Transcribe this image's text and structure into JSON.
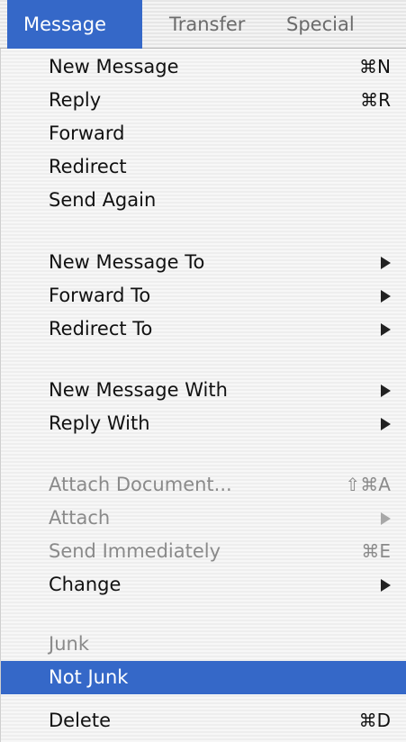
{
  "menubar": {
    "titles": [
      "Message",
      "Transfer",
      "Special"
    ],
    "colors": {
      "highlight": "#3568c8",
      "disabled_text": "#8a8a8a"
    }
  },
  "menu": {
    "items": [
      {
        "label": "New Message",
        "shortcut": "⌘N",
        "submenu": false,
        "enabled": true
      },
      {
        "label": "Reply",
        "shortcut": "⌘R",
        "submenu": false,
        "enabled": true
      },
      {
        "label": "Forward",
        "shortcut": "",
        "submenu": false,
        "enabled": true
      },
      {
        "label": "Redirect",
        "shortcut": "",
        "submenu": false,
        "enabled": true
      },
      {
        "label": "Send Again",
        "shortcut": "",
        "submenu": false,
        "enabled": true
      },
      {
        "label": "New Message To",
        "shortcut": "",
        "submenu": true,
        "enabled": true
      },
      {
        "label": "Forward To",
        "shortcut": "",
        "submenu": true,
        "enabled": true
      },
      {
        "label": "Redirect To",
        "shortcut": "",
        "submenu": true,
        "enabled": true
      },
      {
        "label": "New Message With",
        "shortcut": "",
        "submenu": true,
        "enabled": true
      },
      {
        "label": "Reply With",
        "shortcut": "",
        "submenu": true,
        "enabled": true
      },
      {
        "label": "Attach Document...",
        "shortcut": "⇧⌘A",
        "submenu": false,
        "enabled": false
      },
      {
        "label": "Attach",
        "shortcut": "",
        "submenu": true,
        "enabled": false
      },
      {
        "label": "Send Immediately",
        "shortcut": "⌘E",
        "submenu": false,
        "enabled": false
      },
      {
        "label": "Change",
        "shortcut": "",
        "submenu": true,
        "enabled": true
      },
      {
        "label": "Junk",
        "shortcut": "",
        "submenu": false,
        "enabled": false
      },
      {
        "label": "Not Junk",
        "shortcut": "",
        "submenu": false,
        "enabled": true,
        "highlighted": true
      },
      {
        "label": "Delete",
        "shortcut": "⌘D",
        "submenu": false,
        "enabled": true
      }
    ]
  }
}
